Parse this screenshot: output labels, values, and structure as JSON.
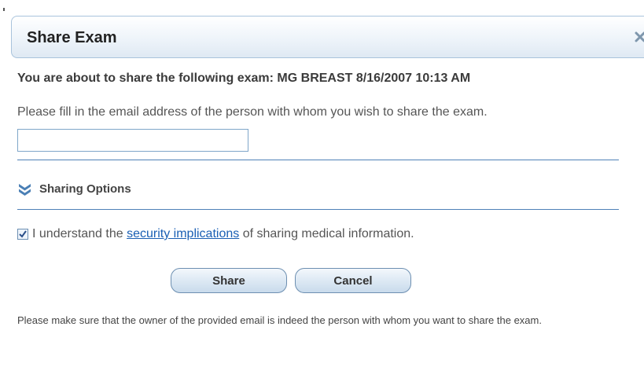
{
  "dialog": {
    "title": "Share Exam",
    "close_icon": "close-icon"
  },
  "intro": "You are about to share the following exam: MG BREAST 8/16/2007 10:13 AM",
  "instructions": "Please fill in the email address of the person with whom you wish to share the exam.",
  "email_field": {
    "value": "",
    "placeholder": ""
  },
  "sharing_options": {
    "icon": "chevrons-down-icon",
    "label": "Sharing Options"
  },
  "consent": {
    "checked": true,
    "text_before": "I understand the",
    "link_text": "security implications",
    "text_after": "of sharing medical information."
  },
  "buttons": {
    "share_label": "Share",
    "cancel_label": "Cancel"
  },
  "note": "Please make sure that the owner of the provided email is indeed the person with whom you want to share the exam.",
  "colors": {
    "accent": "#4f81b8",
    "link": "#1a5fb4",
    "title_border": "#a9c3dc"
  }
}
